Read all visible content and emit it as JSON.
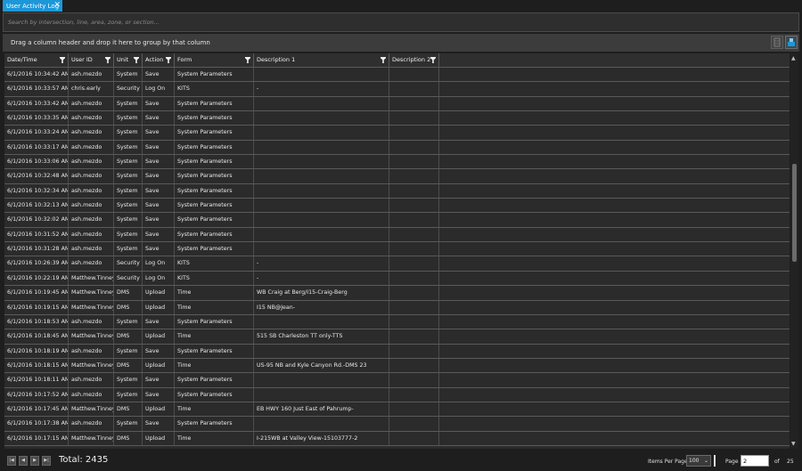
{
  "tab": {
    "title": "User Activity Log",
    "close_glyph": "✕"
  },
  "search": {
    "placeholder": "Search by intersection, line, area, zone, or section...",
    "value": ""
  },
  "group_bar": {
    "hint": "Drag a column header and drop it here to group by that column"
  },
  "columns": [
    {
      "label": "Date/Time"
    },
    {
      "label": "User ID"
    },
    {
      "label": "Unit"
    },
    {
      "label": "Action"
    },
    {
      "label": "Form"
    },
    {
      "label": "Description 1"
    },
    {
      "label": "Description 2"
    }
  ],
  "rows": [
    [
      "6/1/2016 10:34:42 AM",
      "ash.mezdo",
      "System",
      "Save",
      "System Parameters",
      "",
      ""
    ],
    [
      "6/1/2016 10:33:57 AM",
      "chris.early",
      "Security",
      "Log On",
      "KITS",
      "-",
      ""
    ],
    [
      "6/1/2016 10:33:42 AM",
      "ash.mezdo",
      "System",
      "Save",
      "System Parameters",
      "",
      ""
    ],
    [
      "6/1/2016 10:33:35 AM",
      "ash.mezdo",
      "System",
      "Save",
      "System Parameters",
      "",
      ""
    ],
    [
      "6/1/2016 10:33:24 AM",
      "ash.mezdo",
      "System",
      "Save",
      "System Parameters",
      "",
      ""
    ],
    [
      "6/1/2016 10:33:17 AM",
      "ash.mezdo",
      "System",
      "Save",
      "System Parameters",
      "",
      ""
    ],
    [
      "6/1/2016 10:33:06 AM",
      "ash.mezdo",
      "System",
      "Save",
      "System Parameters",
      "",
      ""
    ],
    [
      "6/1/2016 10:32:48 AM",
      "ash.mezdo",
      "System",
      "Save",
      "System Parameters",
      "",
      ""
    ],
    [
      "6/1/2016 10:32:34 AM",
      "ash.mezdo",
      "System",
      "Save",
      "System Parameters",
      "",
      ""
    ],
    [
      "6/1/2016 10:32:13 AM",
      "ash.mezdo",
      "System",
      "Save",
      "System Parameters",
      "",
      ""
    ],
    [
      "6/1/2016 10:32:02 AM",
      "ash.mezdo",
      "System",
      "Save",
      "System Parameters",
      "",
      ""
    ],
    [
      "6/1/2016 10:31:52 AM",
      "ash.mezdo",
      "System",
      "Save",
      "System Parameters",
      "",
      ""
    ],
    [
      "6/1/2016 10:31:28 AM",
      "ash.mezdo",
      "System",
      "Save",
      "System Parameters",
      "",
      ""
    ],
    [
      "6/1/2016 10:26:39 AM",
      "ash.mezdo",
      "Security",
      "Log On",
      "KITS",
      "-",
      ""
    ],
    [
      "6/1/2016 10:22:19 AM",
      "Matthew.Tinney",
      "Security",
      "Log On",
      "KITS",
      "-",
      ""
    ],
    [
      "6/1/2016 10:19:45 AM",
      "Matthew.Tinney",
      "DMS",
      "Upload",
      "Time",
      "WB Craig at Berg/I15-Craig-Berg",
      ""
    ],
    [
      "6/1/2016 10:19:15 AM",
      "Matthew.Tinney",
      "DMS",
      "Upload",
      "Time",
      "I15 NB@Jean-",
      ""
    ],
    [
      "6/1/2016 10:18:53 AM",
      "ash.mezdo",
      "System",
      "Save",
      "System Parameters",
      "",
      ""
    ],
    [
      "6/1/2016 10:18:45 AM",
      "Matthew.Tinney",
      "DMS",
      "Upload",
      "Time",
      "515 SB Charleston TT only-TTS",
      ""
    ],
    [
      "6/1/2016 10:18:19 AM",
      "ash.mezdo",
      "System",
      "Save",
      "System Parameters",
      "",
      ""
    ],
    [
      "6/1/2016 10:18:15 AM",
      "Matthew.Tinney",
      "DMS",
      "Upload",
      "Time",
      "US-95 NB and Kyle Canyon Rd.-DMS 23",
      ""
    ],
    [
      "6/1/2016 10:18:11 AM",
      "ash.mezdo",
      "System",
      "Save",
      "System Parameters",
      "",
      ""
    ],
    [
      "6/1/2016 10:17:52 AM",
      "ash.mezdo",
      "System",
      "Save",
      "System Parameters",
      "",
      ""
    ],
    [
      "6/1/2016 10:17:45 AM",
      "Matthew.Tinney",
      "DMS",
      "Upload",
      "Time",
      "EB HWY 160 Just East of Pahrump-",
      ""
    ],
    [
      "6/1/2016 10:17:38 AM",
      "ash.mezdo",
      "System",
      "Save",
      "System Parameters",
      "",
      ""
    ],
    [
      "6/1/2016 10:17:15 AM",
      "Matthew.Tinney",
      "DMS",
      "Upload",
      "Time",
      "I-215WB at Valley View-15103777-2",
      ""
    ]
  ],
  "footer": {
    "total_label": "Total: 2435",
    "items_per_page_label": "Items Per Page",
    "items_per_page_value": "100",
    "page_label": "Page",
    "page_value": "2",
    "of_label": "of",
    "page_count": "25"
  },
  "pager_icons": [
    "first-page-icon",
    "prev-page-icon",
    "next-page-icon",
    "last-page-icon"
  ],
  "colors": {
    "accent": "#1c97d8",
    "background": "#2b2b2b",
    "gridline": "#5a5a5a"
  }
}
